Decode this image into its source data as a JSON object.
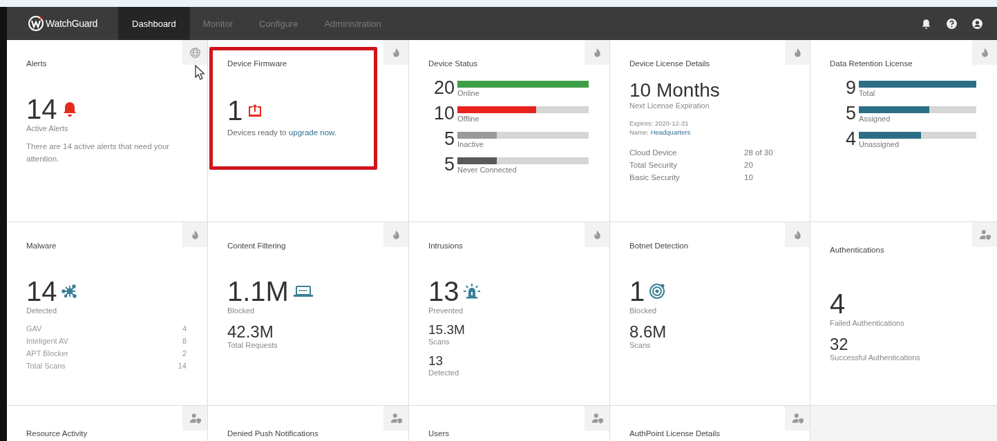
{
  "nav": {
    "logo": "WatchGuard",
    "tabs": [
      {
        "label": "Dashboard",
        "selected": true
      },
      {
        "label": "Monitor",
        "selected": false
      },
      {
        "label": "Configure",
        "selected": false
      },
      {
        "label": "Administration",
        "selected": false
      }
    ]
  },
  "cards": [
    {
      "kind": "alerts",
      "title": "Alerts",
      "value": "14",
      "caption": "Active Alerts",
      "text": "There are 14 active alerts that need your attention."
    },
    {
      "kind": "firmware",
      "title": "Device Firmware",
      "value": "1",
      "text": "Devices ready to ",
      "link": "upgrade now.",
      "highlighted": true
    },
    {
      "kind": "bars",
      "title": "Device Status",
      "bars": [
        {
          "value": "20",
          "label": "Online",
          "level": 1,
          "color": "#3d9e48"
        },
        {
          "value": "10",
          "label": "Offline",
          "level": 0.6,
          "color": "#e8231d"
        },
        {
          "value": "5",
          "label": "Inactive",
          "level": 0.3,
          "color": "#9a9a9a"
        },
        {
          "value": "5",
          "label": "Never Connected",
          "level": 0.3,
          "color": "#5a5a5a"
        }
      ]
    },
    {
      "kind": "license",
      "title": "Device License Details",
      "value": "10 Months",
      "caption": "Next License Expiration",
      "expires": "Expires: 2020-12-31",
      "name_label": "Name:",
      "name_link": "Headquarters",
      "rows": [
        {
          "label": "Cloud Device",
          "value": "28 of 30"
        },
        {
          "label": "Total Security",
          "value": "20"
        },
        {
          "label": "Basic Security",
          "value": "10"
        }
      ]
    },
    {
      "kind": "bars",
      "title": "Data Retention License",
      "bars": [
        {
          "value": "9",
          "label": "Total",
          "level": 1,
          "color": "#2c6e86"
        },
        {
          "value": "5",
          "label": "Assigned",
          "level": 0.6,
          "color": "#2c6e86"
        },
        {
          "value": "4",
          "label": "Unassigned",
          "level": 0.53,
          "color": "#2c6e86"
        }
      ]
    },
    {
      "kind": "malware",
      "title": "Malware",
      "value": "14",
      "caption": "Detected",
      "rows": [
        {
          "label": "GAV",
          "value": "4"
        },
        {
          "label": "Inteligent AV",
          "value": "8"
        },
        {
          "label": "APT Blocker",
          "value": "2"
        },
        {
          "label": "Total Scans",
          "value": "14"
        }
      ]
    },
    {
      "kind": "content",
      "title": "Content Filtering",
      "value": "1.1M",
      "caption": "Blocked",
      "metrics": [
        {
          "value": "42.3M",
          "caption": "Total Requests"
        }
      ]
    },
    {
      "kind": "intrusions",
      "title": "Intrusions",
      "value": "13",
      "caption": "Prevented",
      "metrics": [
        {
          "value": "15.3M",
          "caption": "Scans"
        },
        {
          "value": "13",
          "caption": "Detected"
        }
      ]
    },
    {
      "kind": "botnet",
      "title": "Botnet Detection",
      "value": "1",
      "caption": "Blocked",
      "metrics": [
        {
          "value": "8.6M",
          "caption": "Scans"
        }
      ]
    },
    {
      "kind": "auth",
      "title": "Authentications",
      "value": "4",
      "caption": "Failed Authentications",
      "metrics": [
        {
          "value": "32",
          "caption": "Successful Authentications"
        }
      ]
    },
    {
      "kind": "footer",
      "title": "Resource Activity"
    },
    {
      "kind": "footer",
      "title": "Denied Push Notifications"
    },
    {
      "kind": "footer",
      "title": "Users"
    },
    {
      "kind": "footer",
      "title": "AuthPoint License Details"
    }
  ]
}
